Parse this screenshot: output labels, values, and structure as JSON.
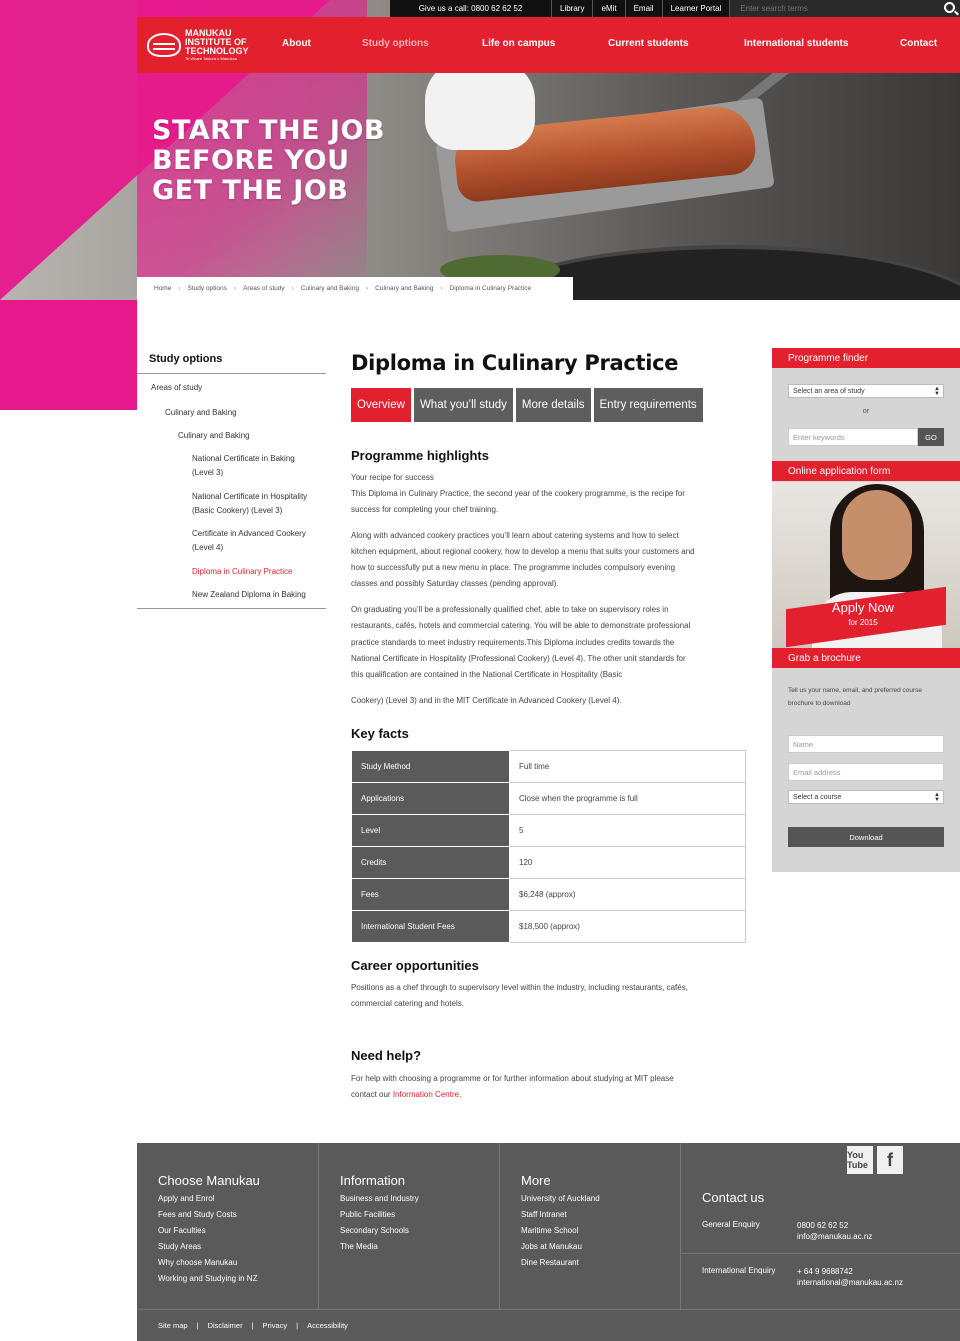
{
  "topbar": {
    "call": "Give us a call: 0800 62 62 52",
    "links": [
      "Library",
      "eMit",
      "Email",
      "Learner Portal"
    ],
    "search_placeholder": "Enter search terms"
  },
  "logo": {
    "line1": "MANUKAU",
    "line2": "INSTITUTE OF",
    "line3": "TECHNOLOGY",
    "tagline": "Te Whare Takiura o Manukau"
  },
  "nav": {
    "items": [
      "About",
      "Study options",
      "Life on campus",
      "Current students",
      "International students",
      "Contact"
    ]
  },
  "hero": {
    "lines": [
      "START THE JOB",
      "BEFORE YOU",
      "GET THE JOB"
    ]
  },
  "breadcrumb": [
    "Home",
    "Study options",
    "Areas of study",
    "Culinary and Baking",
    "Culinary and Baking",
    "Diploma in Culinary Practice"
  ],
  "sidebar": {
    "heading": "Study options",
    "items": [
      "Areas of study",
      "Culinary and Baking",
      "Culinary and Baking",
      "National Certificate in Baking",
      "(Level 3)",
      "National Certificate in Hospitality",
      "(Basic Cookery) (Level 3)",
      "Certificate in Advanced Cookery",
      "(Level 4)",
      "Diploma in Culinary Practice",
      "New Zealand Diploma in Baking"
    ]
  },
  "main": {
    "title": "Diploma in Culinary Practice",
    "tabs": [
      "Overview",
      "What you’ll study",
      "More details",
      "Entry requirements"
    ],
    "highlights_heading": "Programme highlights",
    "recipe": "Your recipe for success",
    "p1a": "This Diploma in Culinary Practice, the second year of the cookery programme, is the recipe for",
    "p1b": "success for completing your chef training.",
    "p2a": "Along with advanced cookery practices you’ll learn about catering systems and how to select",
    "p2b": "kitchen equipment, about regional cookery, how to develop a menu that suits your customers and",
    "p2c": "how to successfully put a new menu in place. The programme includes compulsory evening",
    "p2d": "classes and possibly Saturday classes (pending approval).",
    "p3a": "On graduating you’ll be a professionally qualified chef, able to take on supervisory roles in",
    "p3b": "restaurants, cafés, hotels and commercial catering. You will be able to demonstrate professional",
    "p3c": "practice standards to meet industry requirements.This Diploma includes credits towards the",
    "p3d": "National Certificate in Hospitality (Professional Cookery) (Level 4). The other unit standards for",
    "p3e": "this qualification are contained in the National Certificate in Hospitality (Basic",
    "p4": "Cookery) (Level 3) and in the MIT Certificate in Advanced Cookery (Level 4).",
    "facts_heading": "Key facts",
    "facts": [
      {
        "k": "Study Method",
        "v": "Full time"
      },
      {
        "k": "Applications",
        "v": "Close when the programme is full"
      },
      {
        "k": "Level",
        "v": "5"
      },
      {
        "k": "Credits",
        "v": "120"
      },
      {
        "k": "Fees",
        "v": "$6,248 (approx)"
      },
      {
        "k": "International Student Fees",
        "v": "$18,500 (approx)"
      }
    ],
    "career_heading": "Career opportunities",
    "career_a": "Positions as a chef through to supervisory level within the industry, including restaurants, cafés,",
    "career_b": "commercial catering and hotels.",
    "help_heading": "Need help?",
    "help_a": "For help with choosing a programme or for further information about studying at MIT please",
    "help_b": "contact our ",
    "help_link": "Information Centre",
    "help_end": "."
  },
  "right": {
    "finder_heading": "Programme finder",
    "area_select": "Select an area of study",
    "or": "or",
    "keywords_placeholder": "Enter keywords",
    "go": "GO",
    "online_heading": "Online application form",
    "apply": "Apply Now",
    "apply_sub": "for 2015",
    "brochure_heading": "Grab a brochure",
    "brochure_text_a": "Tell us your name, email, and preferred course",
    "brochure_text_b": "brochure to download",
    "name_placeholder": "Name",
    "email_placeholder": "Email address",
    "course_select": "Select a course",
    "download": "Download"
  },
  "footer": {
    "col1": {
      "heading": "Choose Manukau",
      "links": [
        "Apply and Enrol",
        "Fees and Study Costs",
        "Our Faculties",
        "Study Areas",
        "Why choose Manukau",
        "Working and Studying in NZ"
      ]
    },
    "col2": {
      "heading": "Information",
      "links": [
        "Business and Industry",
        "Public Facilities",
        "Secondary Schools",
        "The Media"
      ]
    },
    "col3": {
      "heading": "More",
      "links": [
        "University of Auckland",
        "Staff Intranet",
        "Maritime School",
        "Jobs at Manukau",
        "Dine Restaurant"
      ]
    },
    "contact": {
      "heading": "Contact us",
      "general_label": "General Enquiry",
      "general_phone": "0800 62 62 52",
      "general_email": "info@manukau.ac.nz",
      "intl_label": "International Enquiry",
      "intl_phone": "+ 64 9 9688742",
      "intl_email": "international@manukau.ac.nz"
    },
    "social": [
      "You Tube",
      "f"
    ],
    "bottom": [
      "Site map",
      "Disclaimer",
      "Privacy",
      "Accessibility"
    ]
  }
}
